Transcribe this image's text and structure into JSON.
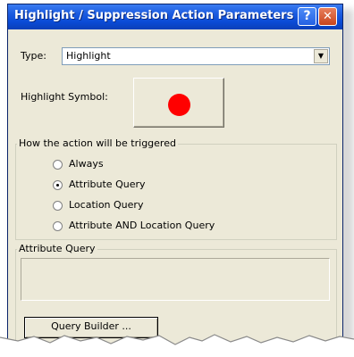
{
  "window": {
    "title": "Highlight / Suppression Action Parameters",
    "help_button": "?",
    "close_button": "✕"
  },
  "type_field": {
    "label": "Type:",
    "selected_value": "Highlight",
    "arrow": "▼"
  },
  "highlight_symbol": {
    "label": "Highlight Symbol:",
    "symbol_color": "#ff0000"
  },
  "trigger_group": {
    "legend": "How the action will be triggered",
    "options": [
      {
        "label": "Always",
        "selected": false
      },
      {
        "label": "Attribute Query",
        "selected": true
      },
      {
        "label": "Location Query",
        "selected": false
      },
      {
        "label": "Attribute AND Location Query",
        "selected": false
      }
    ]
  },
  "attribute_query_group": {
    "legend": "Attribute Query",
    "query_text": "",
    "query_builder_button": "Query Builder ..."
  },
  "colors": {
    "titlebar": "#0a4bd6",
    "dialog_bg": "#ece9d8",
    "accent": "#ff0000"
  }
}
